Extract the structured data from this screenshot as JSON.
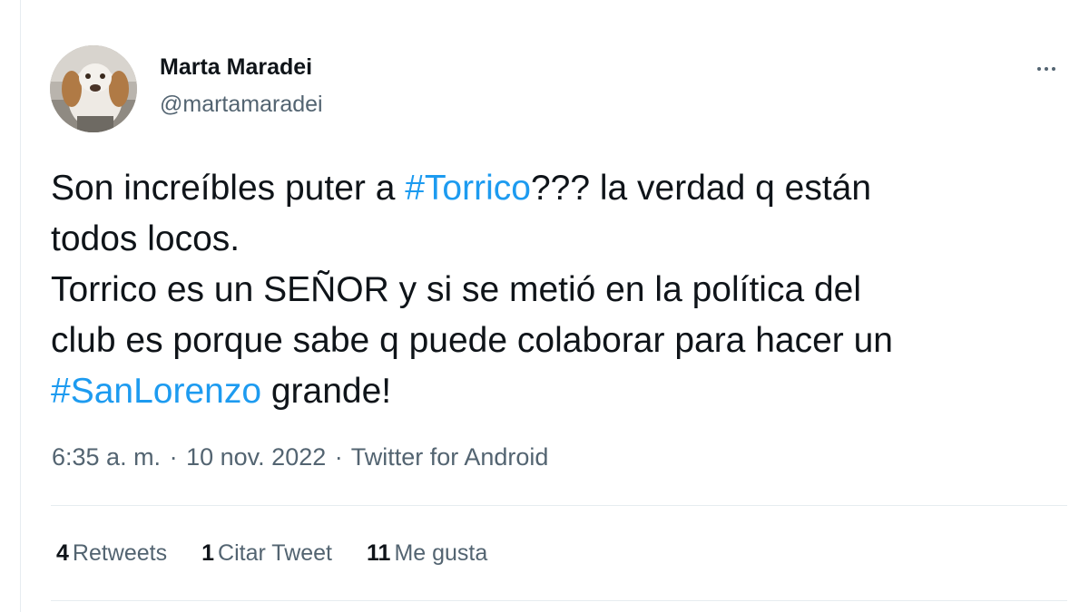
{
  "author": {
    "name": "Marta Maradei",
    "handle": "@martamaradei",
    "avatar_icon": "dog-photo-avatar"
  },
  "more_icon": "more-horizontal-icon",
  "tweet": {
    "lines": [
      [
        {
          "text": "Son increíbles puter a ",
          "type": "text"
        },
        {
          "text": "#Torrico",
          "type": "hashtag"
        },
        {
          "text": "??? la verdad q están",
          "type": "text"
        }
      ],
      [
        {
          "text": "todos locos.",
          "type": "text"
        }
      ],
      [
        {
          "text": "Torrico es un SEÑOR y si se metió en la política del",
          "type": "text"
        }
      ],
      [
        {
          "text": "club es porque sabe q puede colaborar para hacer un",
          "type": "text"
        }
      ],
      [
        {
          "text": "#SanLorenzo",
          "type": "hashtag"
        },
        {
          "text": " grande!",
          "type": "text"
        }
      ]
    ]
  },
  "meta": {
    "time": "6:35 a. m.",
    "separator": "·",
    "date": "10 nov. 2022",
    "source": "Twitter for Android"
  },
  "stats": {
    "retweets_count": "4",
    "retweets_label": "Retweets",
    "quotes_count": "1",
    "quotes_label": "Citar Tweet",
    "likes_count": "11",
    "likes_label": "Me gusta"
  },
  "colors": {
    "hashtag": "#1d9bf0",
    "secondary_text": "#536471",
    "primary_text": "#0f1419",
    "divider": "#e6ecf0"
  }
}
